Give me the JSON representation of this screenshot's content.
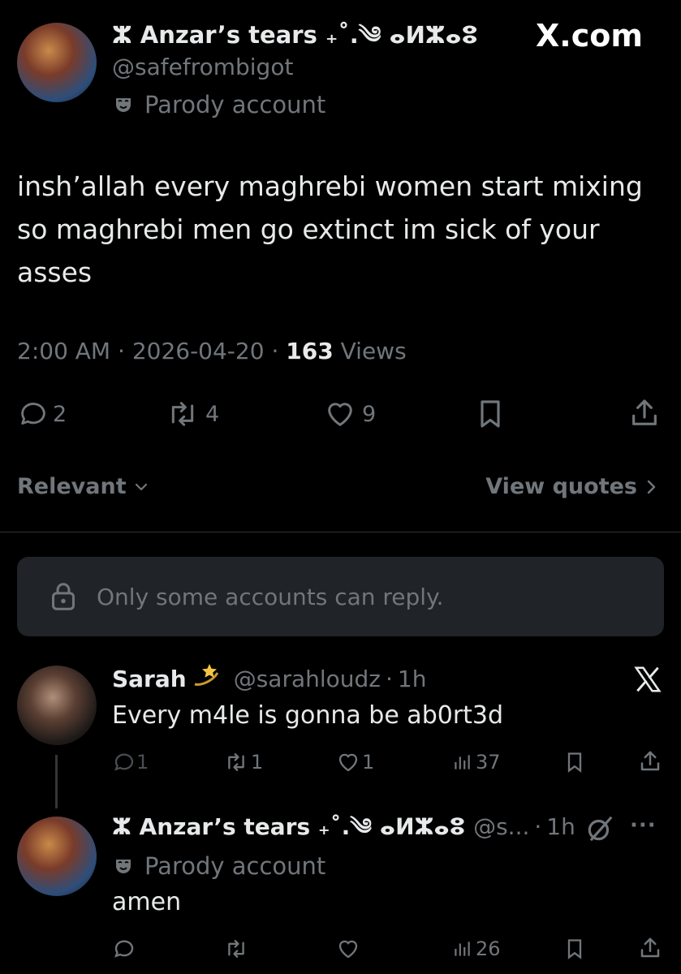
{
  "brand": {
    "logo_text": "X.com"
  },
  "post": {
    "author_name": "ⵣ Anzar’s tears ₊˚.༄ ⴰⵍⵣⴰⵓ",
    "handle": "@safefrombigot",
    "parody_label": "Parody account",
    "text": "insh’allah every maghrebi women start mixing so maghrebi men go extinct im sick of your asses",
    "time": "2:00 AM",
    "date": "2026-04-20",
    "sep": "·",
    "views_count": "163",
    "views_label": "Views",
    "replies": "2",
    "reposts": "4",
    "likes": "9"
  },
  "filter": {
    "sort_label": "Relevant",
    "view_quotes_label": "View quotes"
  },
  "restriction": {
    "text": "Only some accounts can reply."
  },
  "replies": [
    {
      "author_name": "Sarah",
      "handle": "@sarahloudz",
      "time": "1h",
      "text": "Every m4le is gonna be ab0rt3d",
      "replies": "1",
      "reposts": "1",
      "likes": "1",
      "views": "37"
    },
    {
      "author_name": "ⵣ Anzar’s tears ₊˚.༄ ⴰⵍⵣⴰⵓ",
      "handle": "@s...",
      "time": "1h",
      "parody_label": "Parody account",
      "text": "amen",
      "views": "26",
      "more": "···"
    }
  ],
  "colors": {
    "background": "#000000",
    "text": "#e7e9ea",
    "secondary": "#71767b",
    "card": "#202327",
    "divider": "#2f3336"
  }
}
